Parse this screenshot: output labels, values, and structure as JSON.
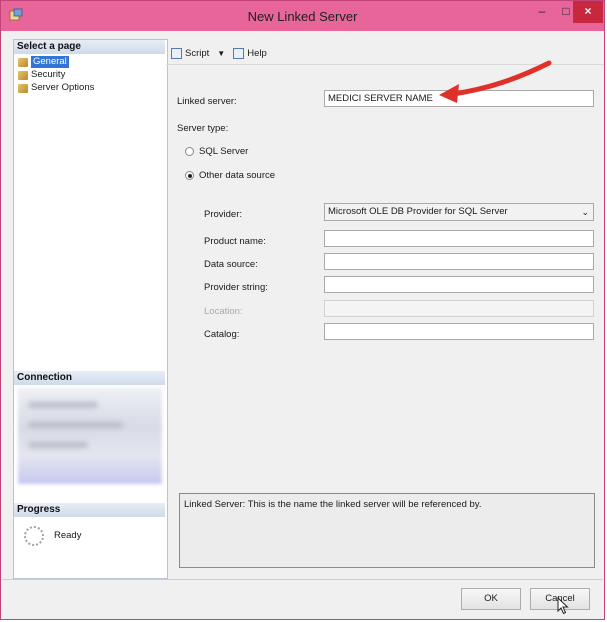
{
  "window": {
    "title": "New Linked Server",
    "controls": {
      "minimize": "–",
      "maximize": "□",
      "close": "×"
    }
  },
  "sidebar": {
    "select_page_header": "Select a page",
    "items": [
      {
        "label": "General",
        "icon": "page-icon",
        "selected": true
      },
      {
        "label": "Security",
        "icon": "page-icon",
        "selected": false
      },
      {
        "label": "Server Options",
        "icon": "page-icon",
        "selected": false
      }
    ],
    "connection_header": "Connection",
    "progress_header": "Progress",
    "progress_status": "Ready"
  },
  "toolbar": {
    "script_label": "Script",
    "help_label": "Help"
  },
  "form": {
    "linked_server_label": "Linked server:",
    "linked_server_value": "MEDICI SERVER NAME",
    "server_type_label": "Server type:",
    "radio_sql_server": "SQL Server",
    "radio_other": "Other data source",
    "selected_server_type": "Other data source",
    "provider_label": "Provider:",
    "provider_value": "Microsoft OLE DB Provider for SQL Server",
    "product_name_label": "Product name:",
    "product_name_value": "",
    "data_source_label": "Data source:",
    "data_source_value": "",
    "provider_string_label": "Provider string:",
    "provider_string_value": "",
    "location_label": "Location:",
    "location_value": "",
    "catalog_label": "Catalog:",
    "catalog_value": ""
  },
  "description": "Linked Server: This is the name the linked server will be referenced by.",
  "buttons": {
    "ok": "OK",
    "cancel": "Cancel"
  },
  "colors": {
    "titlebar": "#e8659a",
    "close": "#c7283d",
    "arrow": "#e0302a",
    "selection": "#3375d6"
  }
}
